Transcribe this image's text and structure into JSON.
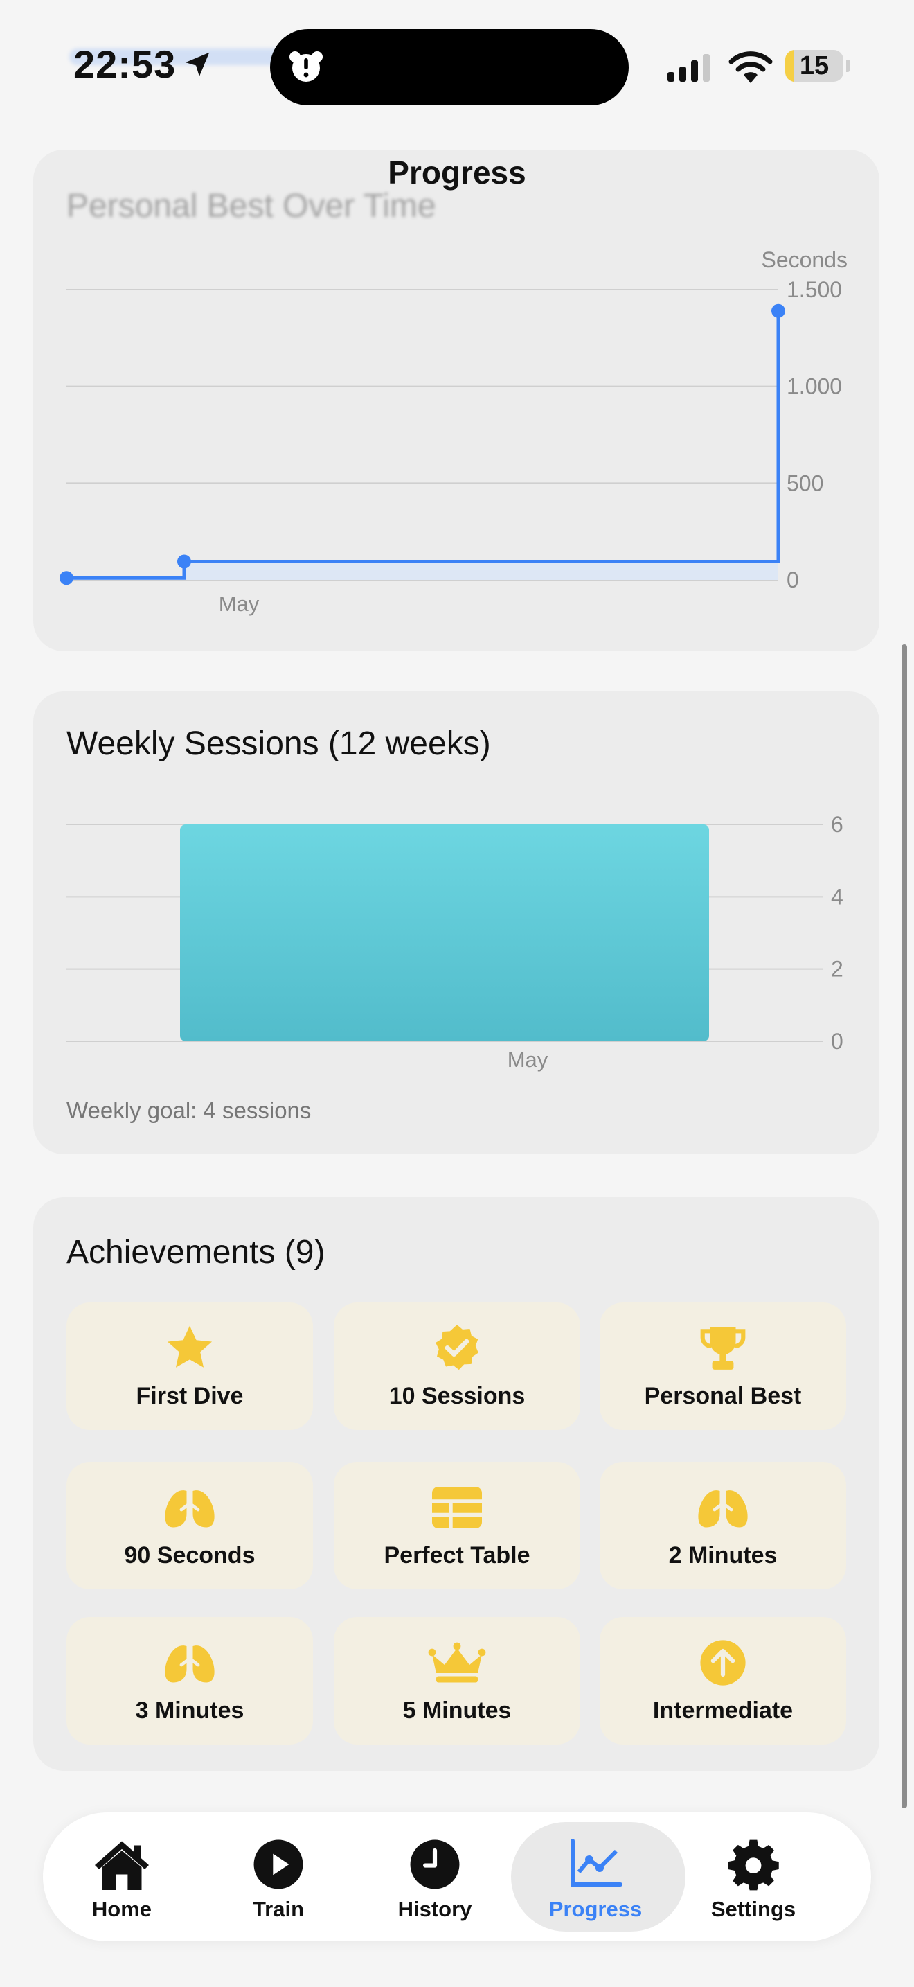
{
  "status_bar": {
    "time": "22:53",
    "battery": "15",
    "battery_level": 0.15,
    "icons": [
      "location-arrow-icon",
      "island-alert-icon",
      "signal-icon",
      "wifi-icon",
      "battery-icon"
    ]
  },
  "page_title": "Progress",
  "personal_best": {
    "title": "Personal Best Over Time",
    "unit_label": "Seconds",
    "chart_data": {
      "type": "line",
      "title": "Personal Best Over Time",
      "ylabel": "Seconds",
      "ylim": [
        0,
        1500
      ],
      "y_ticks": [
        "0",
        "500",
        "1.000",
        "1.500"
      ],
      "x_tick_labels": [
        "May"
      ],
      "step": true,
      "series": [
        {
          "points": [
            {
              "x": "late April",
              "y": 10
            },
            {
              "x": "early May",
              "y": 95
            },
            {
              "x": "late May",
              "y": 1390
            }
          ]
        }
      ]
    }
  },
  "weekly_sessions": {
    "title": "Weekly Sessions (12 weeks)",
    "goal_text": "Weekly goal: 4 sessions",
    "chart_data": {
      "type": "bar",
      "title": "Weekly Sessions (12 weeks)",
      "categories": [
        "May"
      ],
      "values": [
        6
      ],
      "ylim": [
        0,
        6
      ],
      "y_ticks": [
        "0",
        "2",
        "4",
        "6"
      ],
      "colors": [
        "#5cc8d6"
      ]
    }
  },
  "achievements": {
    "title": "Achievements (9)",
    "color": "#f5c838",
    "items": [
      {
        "label": "First Dive",
        "icon": "star-icon"
      },
      {
        "label": "10 Sessions",
        "icon": "checkmark-seal-icon"
      },
      {
        "label": "Personal Best",
        "icon": "trophy-icon"
      },
      {
        "label": "90 Seconds",
        "icon": "lungs-icon"
      },
      {
        "label": "Perfect Table",
        "icon": "table-icon"
      },
      {
        "label": "2 Minutes",
        "icon": "lungs-icon"
      },
      {
        "label": "3 Minutes",
        "icon": "lungs-icon"
      },
      {
        "label": "5 Minutes",
        "icon": "crown-icon"
      },
      {
        "label": "Intermediate",
        "icon": "arrow-up-circle-icon"
      }
    ]
  },
  "tab_bar": {
    "active": "Progress",
    "accent": "#3b82f6",
    "tabs": [
      {
        "label": "Home",
        "icon": "house-icon"
      },
      {
        "label": "Train",
        "icon": "play-circle-icon"
      },
      {
        "label": "History",
        "icon": "clock-icon"
      },
      {
        "label": "Progress",
        "icon": "chart-line-icon"
      },
      {
        "label": "Settings",
        "icon": "gear-icon"
      }
    ]
  }
}
